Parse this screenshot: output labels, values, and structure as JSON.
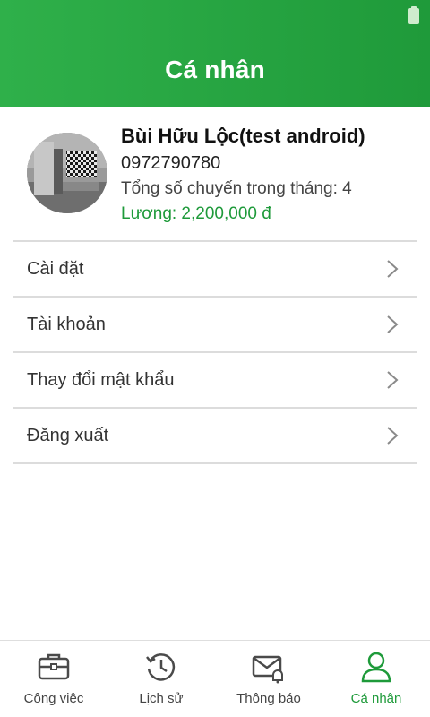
{
  "header": {
    "title": "Cá nhân"
  },
  "profile": {
    "name": "Bùi Hữu Lộc(test android)",
    "phone": "0972790780",
    "trips": "Tổng số chuyến trong tháng: 4",
    "salary": "Lương: 2,200,000 đ"
  },
  "menu": {
    "items": [
      {
        "label": "Cài đặt",
        "icon": "chevron-right-icon"
      },
      {
        "label": "Tài khoản",
        "icon": "chevron-right-icon"
      },
      {
        "label": "Thay đổi mật khẩu",
        "icon": "chevron-right-icon"
      },
      {
        "label": "Đăng xuất",
        "icon": "chevron-right-icon"
      }
    ]
  },
  "bottom_nav": {
    "items": [
      {
        "label": "Công việc",
        "icon": "briefcase-icon",
        "active": false
      },
      {
        "label": "Lịch sử",
        "icon": "history-icon",
        "active": false
      },
      {
        "label": "Thông báo",
        "icon": "mail-bell-icon",
        "active": false
      },
      {
        "label": "Cá nhân",
        "icon": "user-icon",
        "active": true
      }
    ]
  },
  "colors": {
    "header_green": "#2fb04a",
    "accent_green": "#1e9a3a",
    "divider": "#dcdcdc",
    "icon_gray": "#4a4a4a"
  }
}
